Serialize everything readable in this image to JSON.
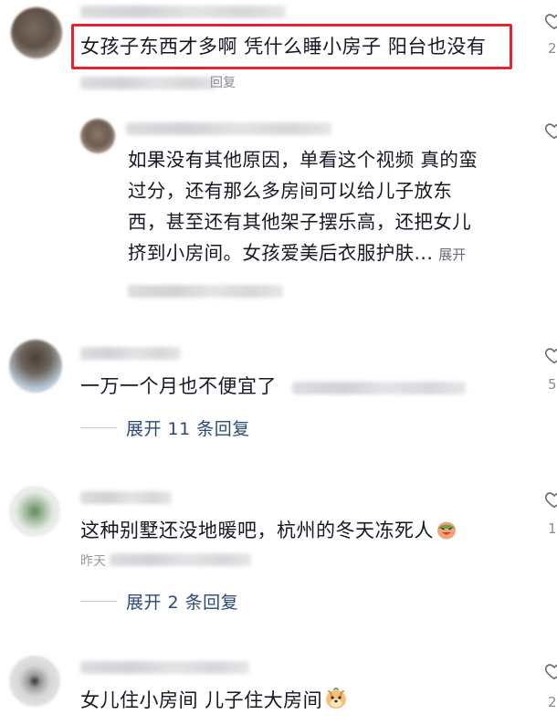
{
  "comments": [
    {
      "text": "女孩子东西才多啊 凭什么睡小房子 阳台也没有",
      "count": "2",
      "reply_label": "回复"
    },
    {
      "text_lines": [
        "如果没有其他原因，单看这个视频 真的蛮",
        "过分，还有那么多房间可以给儿子放东",
        "西，甚至还有其他架子摆乐高，还把女儿",
        "挤到小房间。女孩爱美后衣服护肤..."
      ],
      "expand_label": "展开"
    },
    {
      "text": "一万一个月也不便宜了",
      "count": "5",
      "replies_label": "展开 11 条回复"
    },
    {
      "text": "这种别墅还没地暖吧，杭州的冬天冻死人",
      "count": "1",
      "meta_label": "昨天",
      "replies_label": "展开 2 条回复"
    },
    {
      "text": "女儿住小房间 儿子住大房间",
      "count": "2"
    }
  ],
  "colors": {
    "text": "#161823",
    "link": "#2b4a7a",
    "meta": "#8a8b91",
    "highlight_border": "#e3232d"
  },
  "icons": [
    "heart-outline-icon",
    "tongue-out-emoji-icon",
    "puppy-emoji-icon"
  ]
}
